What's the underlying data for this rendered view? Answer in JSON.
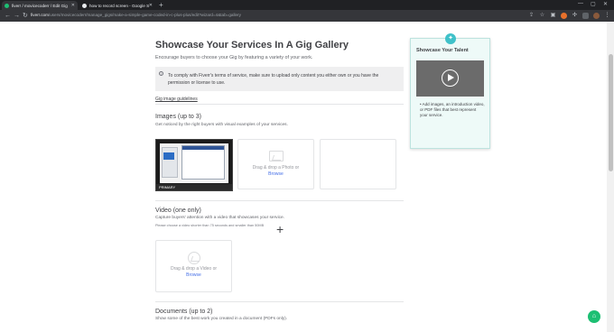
{
  "browser": {
    "tabs": [
      {
        "title": "fiverr / movicecoderr / Edit Gig",
        "active": true,
        "favicon_color": "#1dbf73"
      },
      {
        "title": "how to record screen - Google S",
        "active": false,
        "favicon_color": "#e8eaed"
      }
    ],
    "new_tab_symbol": "+",
    "window_controls": {
      "minimize": "—",
      "maximize": "▢",
      "close": "✕"
    },
    "url_host": "fiverr.com",
    "url_path": "/users/movicecoderr/manage_gigs/make-a-simple-game-coded-in-c-plus-plus/edit?wizard=4&tab=gallery",
    "nav": {
      "back": "←",
      "forward": "→",
      "reload": "↻"
    },
    "extension_icons": [
      "share-icon",
      "bookmark-star-icon",
      "extension-icon",
      "puzzle-icon",
      "profile-icon",
      "menu-icon"
    ]
  },
  "page": {
    "title": "Showcase Your Services In A Gig Gallery",
    "subtitle": "Encourage buyers to choose your Gig by featuring a variety of your work.",
    "notice": "To comply with Fiverr's terms of service, make sure to upload only content you either own or you have the permission or license to use.",
    "guidelines_link": "Gig image guidelines",
    "images": {
      "title": "Images (up to 3)",
      "desc": "Get noticed by the right buyers with visual examples of your services.",
      "primary_label": "PRIMARY",
      "drop_text": "Drag & drop a Photo or",
      "browse": "Browse"
    },
    "video": {
      "title": "Video (one only)",
      "desc": "Capture buyers' attention with a video that showcases your service.",
      "note": "Please choose a video shorter than 75 seconds and smaller than 50MB",
      "drop_text": "Drag & drop a Video or",
      "browse": "Browse"
    },
    "documents": {
      "title": "Documents (up to 2)",
      "desc": "Show some of the best work you created in a document (PDFs only)."
    }
  },
  "sidebar": {
    "title": "Showcase Your Talent",
    "bullet": "Add images, an introduction video, or PDF files that best represent your service."
  },
  "colors": {
    "accent": "#1dbf73",
    "link": "#446ee7",
    "tip_bg": "#eefaf8",
    "bulb": "#3fc1c9"
  }
}
